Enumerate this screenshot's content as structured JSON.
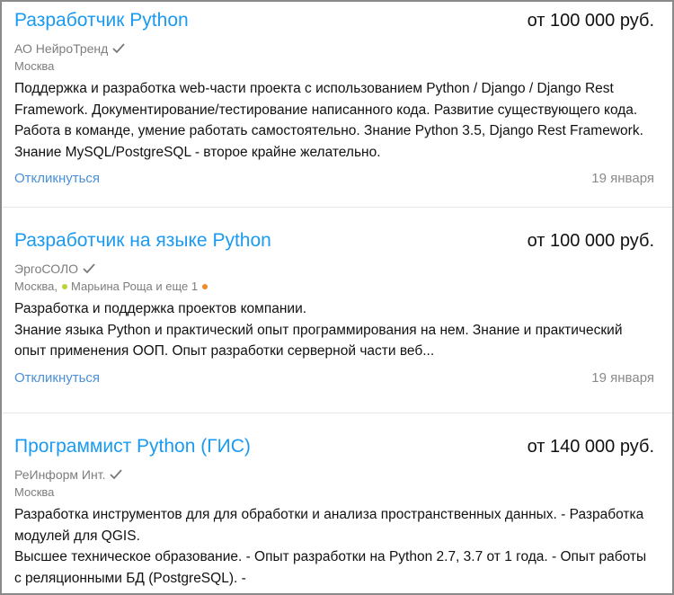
{
  "vacancies": [
    {
      "title": "Разработчик Python",
      "salary": "от 100 000 руб.",
      "company": "АО НейроТренд",
      "city": "Москва",
      "metro": [],
      "description": [
        "Поддержка и разработка web-части проекта с использованием Python / Django / Django Rest Framework. Документирование/тестирование написанного кода. Развитие существующего кода. Работа в команде, умение работать самостоятельно. Знание Python 3.5, Django Rest Framework. Знание MySQL/PostgreSQL - второе крайне желательно."
      ],
      "respond_label": "Откликнуться",
      "date": "19 января"
    },
    {
      "title": "Разработчик на языке Python",
      "salary": "от 100 000 руб.",
      "company": "ЭргоСОЛО",
      "city": "Москва,",
      "metro": [
        {
          "label": "Марьина Роща и еще 1",
          "color_before": "#b7d534",
          "color_after": "#f08a24"
        }
      ],
      "description": [
        "Разработка и поддержка проектов компании.",
        "Знание языка Python и практический опыт программирования на нем. Знание и практический опыт применения ООП. Опыт разработки серверной части веб..."
      ],
      "respond_label": "Откликнуться",
      "date": "19 января"
    },
    {
      "title": "Программист Python (ГИС)",
      "salary": "от 140 000 руб.",
      "company": "РеИнформ Инт.",
      "city": "Москва",
      "metro": [],
      "description": [
        "Разработка инструментов для для обработки и анализа пространственных данных. - Разработка модулей для QGIS.",
        "Высшее техническое образование. - Опыт разработки на Python 2.7, 3.7 от 1 года. - Опыт работы с реляционными БД (PostgreSQL). -"
      ],
      "respond_label": "",
      "date": ""
    }
  ],
  "colors": {
    "title": "#1a9af0",
    "link": "#4a90d9",
    "muted": "#7d7d7d"
  }
}
